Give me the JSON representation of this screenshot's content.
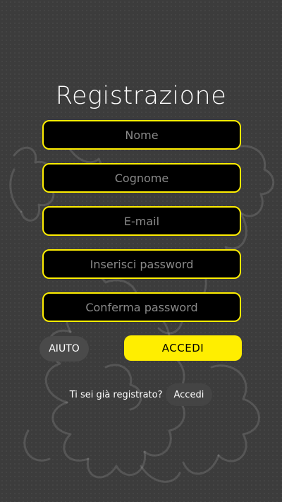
{
  "page": {
    "title": "Registrazione"
  },
  "form": {
    "fields": [
      {
        "placeholder": "Nome",
        "value": ""
      },
      {
        "placeholder": "Cognome",
        "value": ""
      },
      {
        "placeholder": "E-mail",
        "value": ""
      },
      {
        "placeholder": "Inserisci password",
        "value": ""
      },
      {
        "placeholder": "Conferma password",
        "value": ""
      }
    ]
  },
  "actions": {
    "help_label": "AIUTO",
    "login_label": "ACCEDI"
  },
  "footer": {
    "already_text": "Ti sei già registrato?",
    "login_link_label": "Accedi"
  },
  "colors": {
    "background": "#3c3c3c",
    "accent": "#ffee00",
    "field_background": "#000000",
    "text": "#ffffff",
    "placeholder": "#8a8a8a"
  },
  "icons": {
    "background_watermark": "heraldic-lion-icon"
  }
}
